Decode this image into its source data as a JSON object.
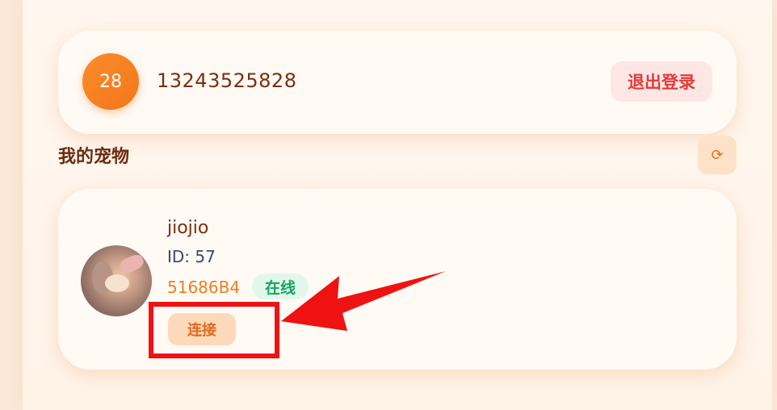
{
  "user": {
    "avatar_text": "28",
    "phone": "13243525828",
    "logout_label": "退出登录"
  },
  "pets_section": {
    "title": "我的宠物",
    "refresh_icon": "⟳"
  },
  "pet": {
    "name": "jiojio",
    "id_text": "ID: 57",
    "code": "51686B4",
    "status": "在线",
    "connect_label": "连接"
  },
  "annotation": {
    "color": "#ef1212"
  }
}
